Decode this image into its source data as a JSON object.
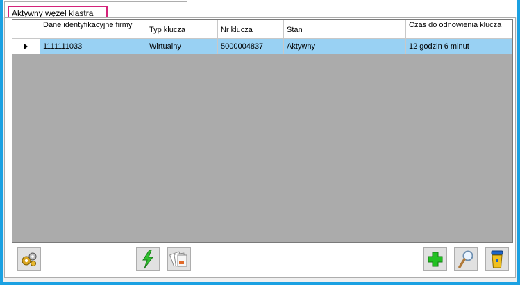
{
  "tabs": [
    {
      "label": "Aktywny węzeł klastra",
      "active": true
    }
  ],
  "grid": {
    "columns": [
      {
        "label": "Dane identyfikacyjne firmy"
      },
      {
        "label": "Typ klucza"
      },
      {
        "label": "Nr klucza"
      },
      {
        "label": "Stan"
      },
      {
        "label": "Czas do odnowienia klucza"
      }
    ],
    "rows": [
      {
        "selected": true,
        "firma": "1111111033",
        "typ": "Wirtualny",
        "nr": "5000004837",
        "stan": "Aktywny",
        "czas": "12 godzin 6 minut"
      }
    ]
  },
  "toolbar": {
    "buttons": [
      {
        "icon": "gears-icon"
      },
      {
        "icon": "lightning-icon"
      },
      {
        "icon": "documents-icon"
      },
      {
        "icon": "plus-icon"
      },
      {
        "icon": "magnifier-icon"
      },
      {
        "icon": "trash-icon"
      }
    ]
  },
  "colors": {
    "window_border": "#1ba1e2",
    "selected_row": "#99d1f3",
    "tab_highlight": "#d4237a",
    "grid_background": "#ababab"
  }
}
